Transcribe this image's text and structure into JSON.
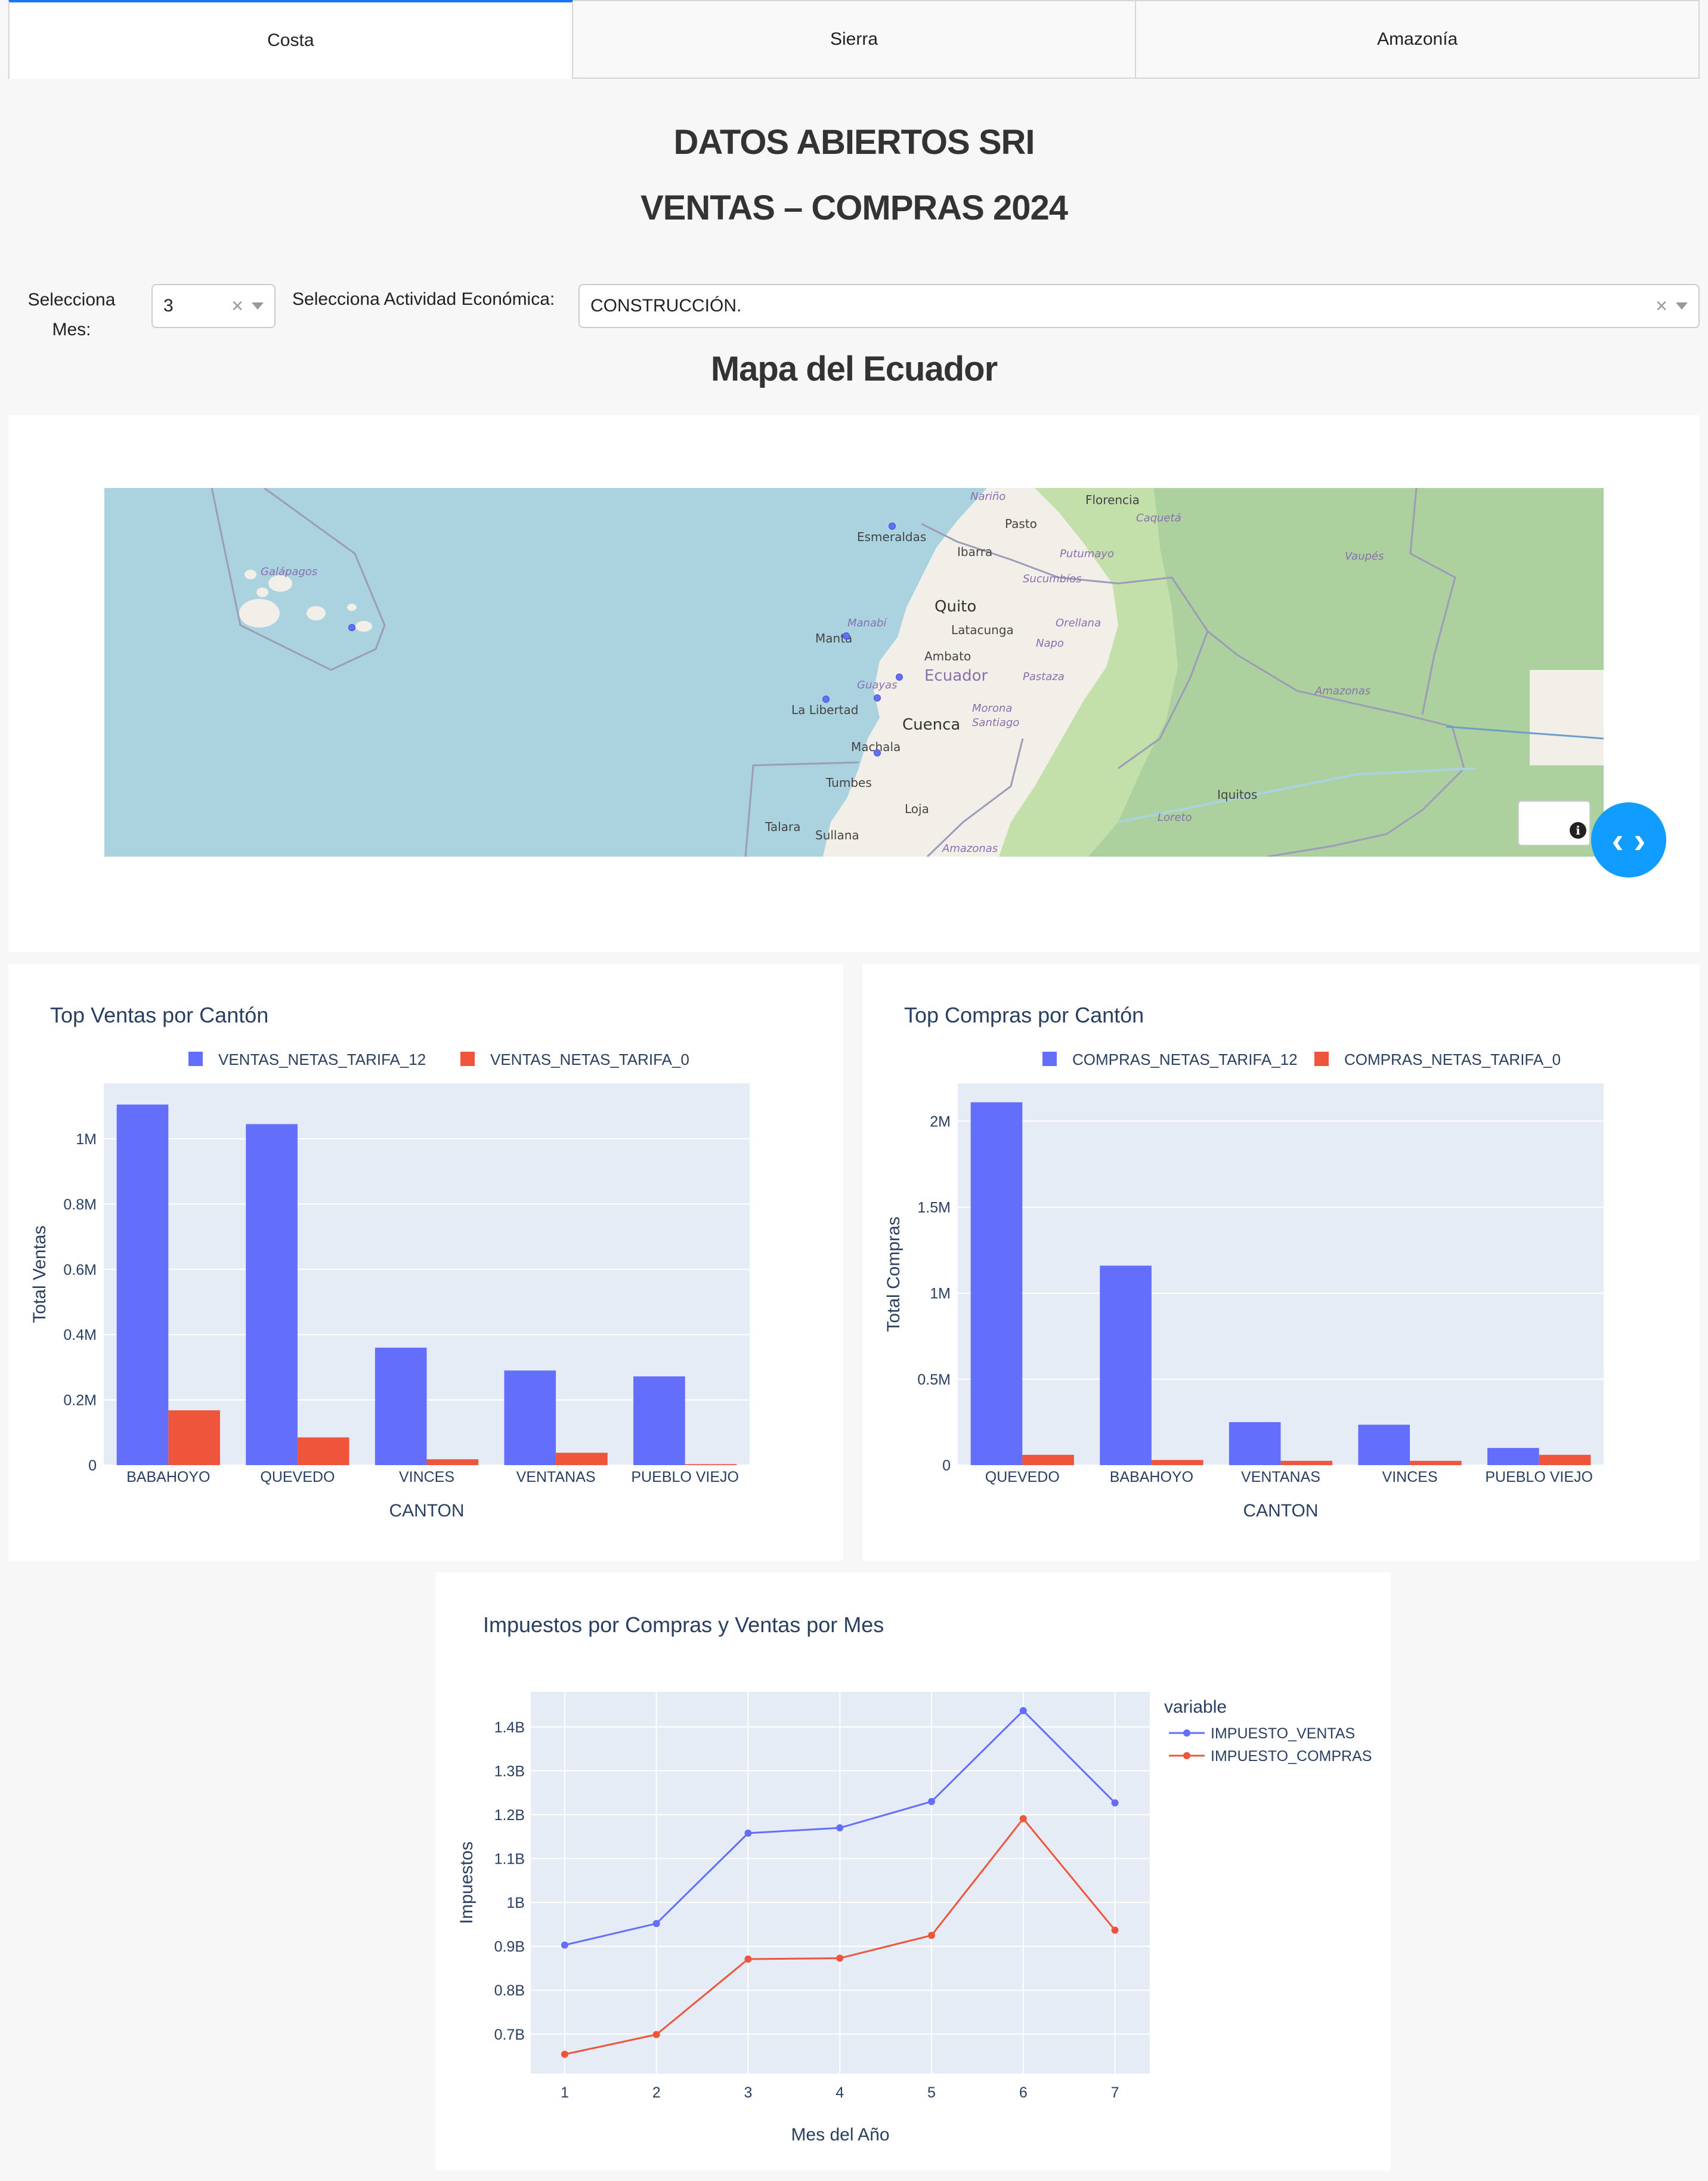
{
  "tabs": [
    {
      "label": "Costa",
      "active": true
    },
    {
      "label": "Sierra",
      "active": false
    },
    {
      "label": "Amazonía",
      "active": false
    }
  ],
  "header": {
    "title1": "DATOS ABIERTOS SRI",
    "title2": "VENTAS – COMPRAS 2024"
  },
  "filters": {
    "month_label": "Selecciona Mes:",
    "month_value": "3",
    "activity_label": "Selecciona Actividad Económica:",
    "activity_value": "CONSTRUCCIÓN.",
    "clear_glyph": "×"
  },
  "map": {
    "title": "Mapa del Ecuador",
    "labels": [
      "Galápagos",
      "Esmeraldas",
      "Ibarra",
      "Quito",
      "Latacunga",
      "Manta",
      "Ambato",
      "Ecuador",
      "Guayas",
      "La Libertad",
      "Cuenca",
      "Machala",
      "Tumbes",
      "Loja",
      "Talara",
      "Sullana",
      "Iquitos",
      "Nariño",
      "Florencia",
      "Pasto",
      "Caquetá",
      "Putumayo",
      "Sucumbíos",
      "Orellana",
      "Napo",
      "Pastaza",
      "Morona Santiago",
      "Manabí",
      "Vaupés",
      "Amazonas",
      "Loreto"
    ],
    "info_glyph": "i",
    "nav_glyph": "‹ ›"
  },
  "colors": {
    "series_blue": "#636efa",
    "series_red": "#ef553b",
    "plot_bg": "#e5ecf6",
    "tab_accent": "#1975FA",
    "nav_button": "#119DFF"
  },
  "charts": {
    "ventas": {
      "title": "Top Ventas por Cantón",
      "xlabel": "CANTON",
      "ylabel": "Total Ventas",
      "y_ticks": [
        "0",
        "0.2M",
        "0.4M",
        "0.6M",
        "0.8M",
        "1M"
      ]
    },
    "compras": {
      "title": "Top Compras por Cantón",
      "xlabel": "CANTON",
      "ylabel": "Total Compras",
      "y_ticks": [
        "0",
        "0.5M",
        "1M",
        "1.5M",
        "2M"
      ]
    },
    "impuestos": {
      "title": "Impuestos por Compras y Ventas por Mes",
      "xlabel": "Mes del Año",
      "ylabel": "Impuestos",
      "legend_title": "variable",
      "y_ticks": [
        "0.7B",
        "0.8B",
        "0.9B",
        "1B",
        "1.1B",
        "1.2B",
        "1.3B",
        "1.4B"
      ],
      "x_ticks": [
        "1",
        "2",
        "3",
        "4",
        "5",
        "6",
        "7"
      ]
    }
  },
  "chart_data": [
    {
      "type": "bar",
      "title": "Top Ventas por Cantón",
      "xlabel": "CANTON",
      "ylabel": "Total Ventas",
      "categories": [
        "BABAHOYO",
        "QUEVEDO",
        "VINCES",
        "VENTANAS",
        "PUEBLO VIEJO"
      ],
      "series": [
        {
          "name": "VENTAS_NETAS_TARIFA_12",
          "values": [
            1105000,
            1045000,
            360000,
            290000,
            272000
          ]
        },
        {
          "name": "VENTAS_NETAS_TARIFA_0",
          "values": [
            168000,
            85000,
            18000,
            38000,
            3000
          ]
        }
      ],
      "ylim": [
        0,
        1170000
      ],
      "legend": "top-center",
      "grid": true
    },
    {
      "type": "bar",
      "title": "Top Compras por Cantón",
      "xlabel": "CANTON",
      "ylabel": "Total Compras",
      "categories": [
        "QUEVEDO",
        "BABAHOYO",
        "VENTANAS",
        "VINCES",
        "PUEBLO VIEJO"
      ],
      "series": [
        {
          "name": "COMPRAS_NETAS_TARIFA_12",
          "values": [
            2110000,
            1160000,
            250000,
            235000,
            100000
          ]
        },
        {
          "name": "COMPRAS_NETAS_TARIFA_0",
          "values": [
            60000,
            30000,
            25000,
            25000,
            60000
          ]
        }
      ],
      "ylim": [
        0,
        2220000
      ],
      "legend": "top-center",
      "grid": true
    },
    {
      "type": "line",
      "title": "Impuestos por Compras y Ventas por Mes",
      "xlabel": "Mes del Año",
      "ylabel": "Impuestos",
      "x": [
        1,
        2,
        3,
        4,
        5,
        6,
        7
      ],
      "series": [
        {
          "name": "IMPUESTO_VENTAS",
          "values": [
            903000000,
            952000000,
            1158000000,
            1170000000,
            1230000000,
            1437000000,
            1227000000
          ]
        },
        {
          "name": "IMPUESTO_COMPRAS",
          "values": [
            654000000,
            699000000,
            871000000,
            873000000,
            925000000,
            1191000000,
            937000000
          ]
        }
      ],
      "xlim": [
        0.63,
        7.38
      ],
      "ylim": [
        610000000.0,
        1480000000.0
      ],
      "legend": "right",
      "grid": true
    }
  ]
}
